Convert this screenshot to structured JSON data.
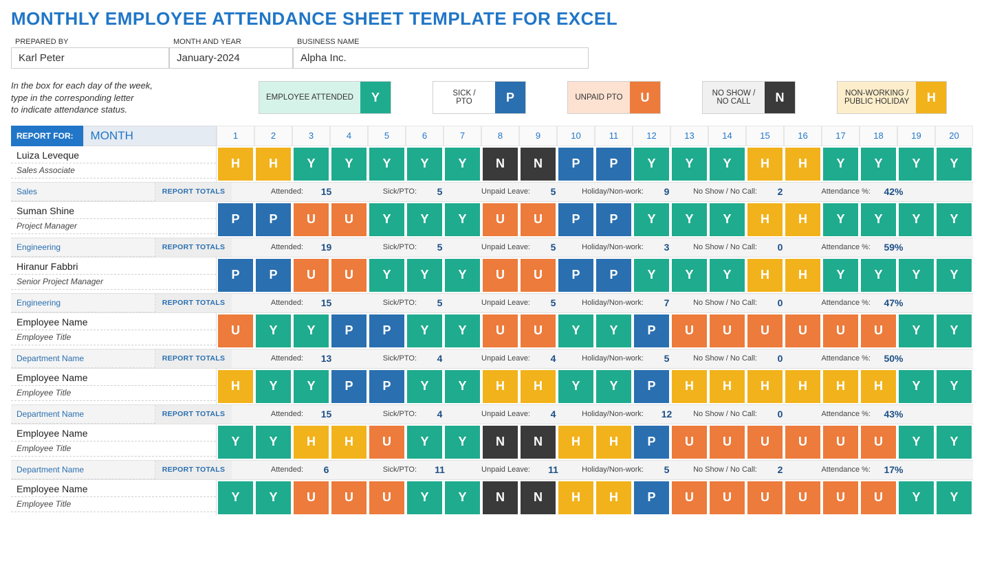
{
  "title": "MONTHLY EMPLOYEE ATTENDANCE SHEET TEMPLATE FOR EXCEL",
  "meta": {
    "prepared_by_label": "PREPARED BY",
    "prepared_by": "Karl Peter",
    "month_year_label": "MONTH AND YEAR",
    "month_year": "January-2024",
    "business_label": "BUSINESS NAME",
    "business": "Alpha Inc."
  },
  "legend": {
    "note_l1": "In the box for each day of the week,",
    "note_l2": "type in the corresponding letter",
    "note_l3": "to indicate attendance status.",
    "items": [
      {
        "label": "EMPLOYEE ATTENDED",
        "code": "Y"
      },
      {
        "label": "SICK / PTO",
        "code": "P"
      },
      {
        "label": "UNPAID PTO",
        "code": "U"
      },
      {
        "label": "NO SHOW / NO CALL",
        "code": "N"
      },
      {
        "label": "NON-WORKING / PUBLIC HOLIDAY",
        "code": "H"
      }
    ]
  },
  "report": {
    "for_label": "REPORT FOR:",
    "month_label": "MONTH",
    "days_shown": 20,
    "totals_label": "REPORT TOTALS",
    "stat_labels": {
      "attended": "Attended:",
      "sick": "Sick/PTO:",
      "unpaid": "Unpaid Leave:",
      "holiday": "Holiday/Non-work:",
      "noshow": "No Show / No Call:",
      "attpct": "Attendance %:"
    }
  },
  "employees": [
    {
      "name": "Luiza Leveque",
      "title": "Sales Associate",
      "dept": "Sales",
      "days": [
        "H",
        "H",
        "Y",
        "Y",
        "Y",
        "Y",
        "Y",
        "N",
        "N",
        "P",
        "P",
        "Y",
        "Y",
        "Y",
        "H",
        "H",
        "Y",
        "Y",
        "Y",
        "Y"
      ],
      "totals": {
        "attended": "15",
        "sick": "5",
        "unpaid": "5",
        "holiday": "9",
        "noshow": "2",
        "attpct": "42%"
      }
    },
    {
      "name": "Suman Shine",
      "title": "Project Manager",
      "dept": "Engineering",
      "days": [
        "P",
        "P",
        "U",
        "U",
        "Y",
        "Y",
        "Y",
        "U",
        "U",
        "P",
        "P",
        "Y",
        "Y",
        "Y",
        "H",
        "H",
        "Y",
        "Y",
        "Y",
        "Y"
      ],
      "totals": {
        "attended": "19",
        "sick": "5",
        "unpaid": "5",
        "holiday": "3",
        "noshow": "0",
        "attpct": "59%"
      }
    },
    {
      "name": "Hiranur Fabbri",
      "title": "Senior Project Manager",
      "dept": "Engineering",
      "days": [
        "P",
        "P",
        "U",
        "U",
        "Y",
        "Y",
        "Y",
        "U",
        "U",
        "P",
        "P",
        "Y",
        "Y",
        "Y",
        "H",
        "H",
        "Y",
        "Y",
        "Y",
        "Y"
      ],
      "totals": {
        "attended": "15",
        "sick": "5",
        "unpaid": "5",
        "holiday": "7",
        "noshow": "0",
        "attpct": "47%"
      }
    },
    {
      "name": "Employee Name",
      "title": "Employee Title",
      "dept": "Department Name",
      "days": [
        "U",
        "Y",
        "Y",
        "P",
        "P",
        "Y",
        "Y",
        "U",
        "U",
        "Y",
        "Y",
        "P",
        "U",
        "U",
        "U",
        "U",
        "U",
        "U",
        "Y",
        "Y"
      ],
      "totals": {
        "attended": "13",
        "sick": "4",
        "unpaid": "4",
        "holiday": "5",
        "noshow": "0",
        "attpct": "50%"
      }
    },
    {
      "name": "Employee Name",
      "title": "Employee Title",
      "dept": "Department Name",
      "days": [
        "H",
        "Y",
        "Y",
        "P",
        "P",
        "Y",
        "Y",
        "H",
        "H",
        "Y",
        "Y",
        "P",
        "H",
        "H",
        "H",
        "H",
        "H",
        "H",
        "Y",
        "Y"
      ],
      "totals": {
        "attended": "15",
        "sick": "4",
        "unpaid": "4",
        "holiday": "12",
        "noshow": "0",
        "attpct": "43%"
      }
    },
    {
      "name": "Employee Name",
      "title": "Employee Title",
      "dept": "Department Name",
      "days": [
        "Y",
        "Y",
        "H",
        "H",
        "U",
        "Y",
        "Y",
        "N",
        "N",
        "H",
        "H",
        "P",
        "U",
        "U",
        "U",
        "U",
        "U",
        "U",
        "Y",
        "Y"
      ],
      "totals": {
        "attended": "6",
        "sick": "11",
        "unpaid": "11",
        "holiday": "5",
        "noshow": "2",
        "attpct": "17%"
      }
    },
    {
      "name": "Employee Name",
      "title": "Employee Title",
      "dept": "",
      "days": [
        "Y",
        "Y",
        "U",
        "U",
        "U",
        "Y",
        "Y",
        "N",
        "N",
        "H",
        "H",
        "P",
        "U",
        "U",
        "U",
        "U",
        "U",
        "U",
        "Y",
        "Y"
      ],
      "totals": null
    }
  ]
}
